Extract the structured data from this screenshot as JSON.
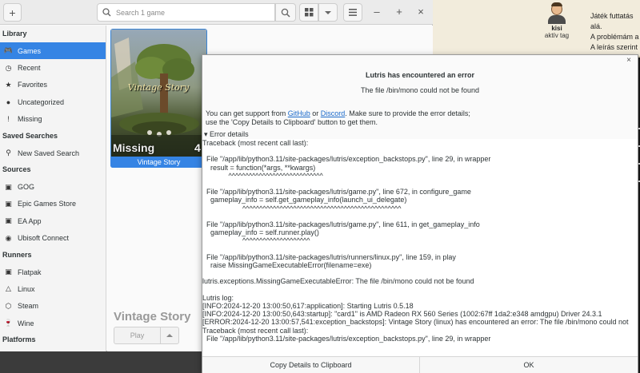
{
  "forum": {
    "username": "kisi",
    "status": "aktív tag",
    "text_lines": [
      "Játék futtatás",
      "alá.",
      "A problémám a",
      "A leírás szerint"
    ]
  },
  "header": {
    "add_icon": "plus-icon",
    "search_placeholder": "Search 1 game",
    "minimize": "–",
    "maximize": "+",
    "close": "×"
  },
  "sidebar": {
    "sections": [
      {
        "title": "Library",
        "items": [
          {
            "label": "Games",
            "icon": "gamepad-icon",
            "glyph": "🎮",
            "active": true
          },
          {
            "label": "Recent",
            "icon": "clock-icon",
            "glyph": "◷"
          },
          {
            "label": "Favorites",
            "icon": "star-icon",
            "glyph": "★"
          },
          {
            "label": "Uncategorized",
            "icon": "pin-icon",
            "glyph": "●"
          },
          {
            "label": "Missing",
            "icon": "warning-icon",
            "glyph": "!"
          }
        ]
      },
      {
        "title": "Saved Searches",
        "items": [
          {
            "label": "New Saved Search",
            "icon": "search-icon",
            "glyph": "⚲"
          }
        ]
      },
      {
        "title": "Sources",
        "items": [
          {
            "label": "GOG",
            "icon": "gog-icon",
            "glyph": "▣"
          },
          {
            "label": "Epic Games Store",
            "icon": "epic-icon",
            "glyph": "▣"
          },
          {
            "label": "EA App",
            "icon": "ea-icon",
            "glyph": "▣"
          },
          {
            "label": "Ubisoft Connect",
            "icon": "ubisoft-icon",
            "glyph": "◉"
          }
        ]
      },
      {
        "title": "Runners",
        "items": [
          {
            "label": "Flatpak",
            "icon": "flatpak-icon",
            "glyph": "▣"
          },
          {
            "label": "Linux",
            "icon": "linux-icon",
            "glyph": "△"
          },
          {
            "label": "Steam",
            "icon": "steam-icon",
            "glyph": "⬡"
          },
          {
            "label": "Wine",
            "icon": "wine-icon",
            "glyph": "🍷"
          }
        ]
      },
      {
        "title": "Platforms",
        "items": []
      }
    ]
  },
  "game": {
    "name": "Vintage Story",
    "cover_title": "Vintage Story",
    "missing_label": "Missing",
    "play_label": "Play"
  },
  "dialog": {
    "title": "Lutris has encountered an error",
    "subtitle": "The file /bin/mono could not be found",
    "support_prefix": "You can get support from ",
    "support_link1": "GitHub",
    "support_mid": " or ",
    "support_link2": "Discord",
    "support_suffix": ". Make sure to provide the error details;",
    "support_line2": "use the 'Copy Details to Clipboard' button to get them.",
    "details_label": "Error details",
    "trace": "Traceback (most recent call last):\n\n  File \"/app/lib/python3.11/site-packages/lutris/exception_backstops.py\", line 29, in wrapper\n    result = function(*args, **kwargs)\n             ^^^^^^^^^^^^^^^^^^^^^^^^^^^^\n\n  File \"/app/lib/python3.11/site-packages/lutris/game.py\", line 672, in configure_game\n    gameplay_info = self.get_gameplay_info(launch_ui_delegate)\n                    ^^^^^^^^^^^^^^^^^^^^^^^^^^^^^^^^^^^^^^^^^^^^^^^\n\n  File \"/app/lib/python3.11/site-packages/lutris/game.py\", line 611, in get_gameplay_info\n    gameplay_info = self.runner.play()\n                    ^^^^^^^^^^^^^^^^^^^^\n\n  File \"/app/lib/python3.11/site-packages/lutris/runners/linux.py\", line 159, in play\n    raise MissingGameExecutableError(filename=exe)\n\nlutris.exceptions.MissingGameExecutableError: The file /bin/mono could not be found\n\nLutris log:\n[INFO:2024-12-20 13:00:50,617:application]: Starting Lutris 0.5.18\n[INFO:2024-12-20 13:00:50,643:startup]: \"card1\" is AMD Radeon RX 560 Series (1002:67ff 1da2:e348 amdgpu) Driver 24.3.1\n[ERROR:2024-12-20 13:00:57,541:exception_backstops]: Vintage Story (linux) has encountered an error: The file /bin/mono could not\nTraceback (most recent call last):\n  File \"/app/lib/python3.11/site-packages/lutris/exception_backstops.py\", line 29, in wrapper",
    "copy_button": "Copy Details to Clipboard",
    "ok_button": "OK",
    "close_glyph": "×"
  }
}
